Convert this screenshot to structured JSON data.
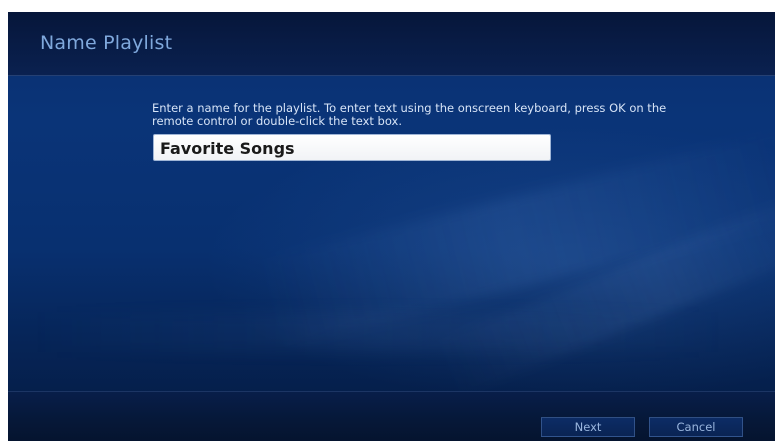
{
  "header": {
    "title": "Name Playlist"
  },
  "main": {
    "instructions": "Enter a name for the playlist. To enter text using the onscreen keyboard, press OK on the remote control or double-click the text box.",
    "name_input": {
      "value": "Favorite Songs",
      "placeholder": ""
    }
  },
  "footer": {
    "next_label": "Next",
    "cancel_label": "Cancel"
  },
  "colors": {
    "background_blue": "#0a3478",
    "title_text": "#7fa8dc",
    "button_text": "#9ab6de"
  }
}
